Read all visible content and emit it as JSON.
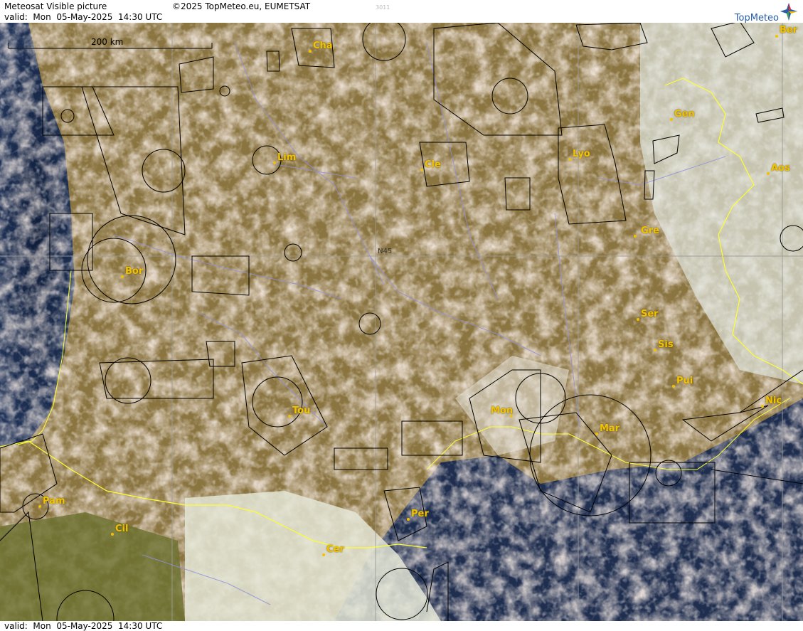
{
  "header": {
    "product": "Meteosat Visible picture",
    "copyright": "©2025 TopMeteo.eu, EUMETSAT",
    "valid": "valid:  Mon  05-May-2025  14:30 UTC",
    "code": "3011",
    "logo": "TopMeteo"
  },
  "footer": {
    "valid": "valid:  Mon  05-May-2025  14:30 UTC"
  },
  "map": {
    "scale_label": "200 km",
    "grid_label": "N45",
    "cities": [
      {
        "name": "Cha"
      },
      {
        "name": "Ber"
      },
      {
        "name": "Gen"
      },
      {
        "name": "Lim"
      },
      {
        "name": "Cle"
      },
      {
        "name": "Lyo"
      },
      {
        "name": "Aos"
      },
      {
        "name": "Gre"
      },
      {
        "name": "Bor"
      },
      {
        "name": "Ser"
      },
      {
        "name": "Sis"
      },
      {
        "name": "Pui"
      },
      {
        "name": "Tou"
      },
      {
        "name": "Mon"
      },
      {
        "name": "Mar"
      },
      {
        "name": "Nic"
      },
      {
        "name": "Pam"
      },
      {
        "name": "Per"
      },
      {
        "name": "Cil"
      },
      {
        "name": "Cer"
      }
    ],
    "colors": {
      "cloud": "#e8cfc0",
      "land": "#7a6a30",
      "sea": "#1a2a4a",
      "border": "#ffff30",
      "river": "#8888dd",
      "airspace": "#000000",
      "city": "#f2c200"
    }
  }
}
